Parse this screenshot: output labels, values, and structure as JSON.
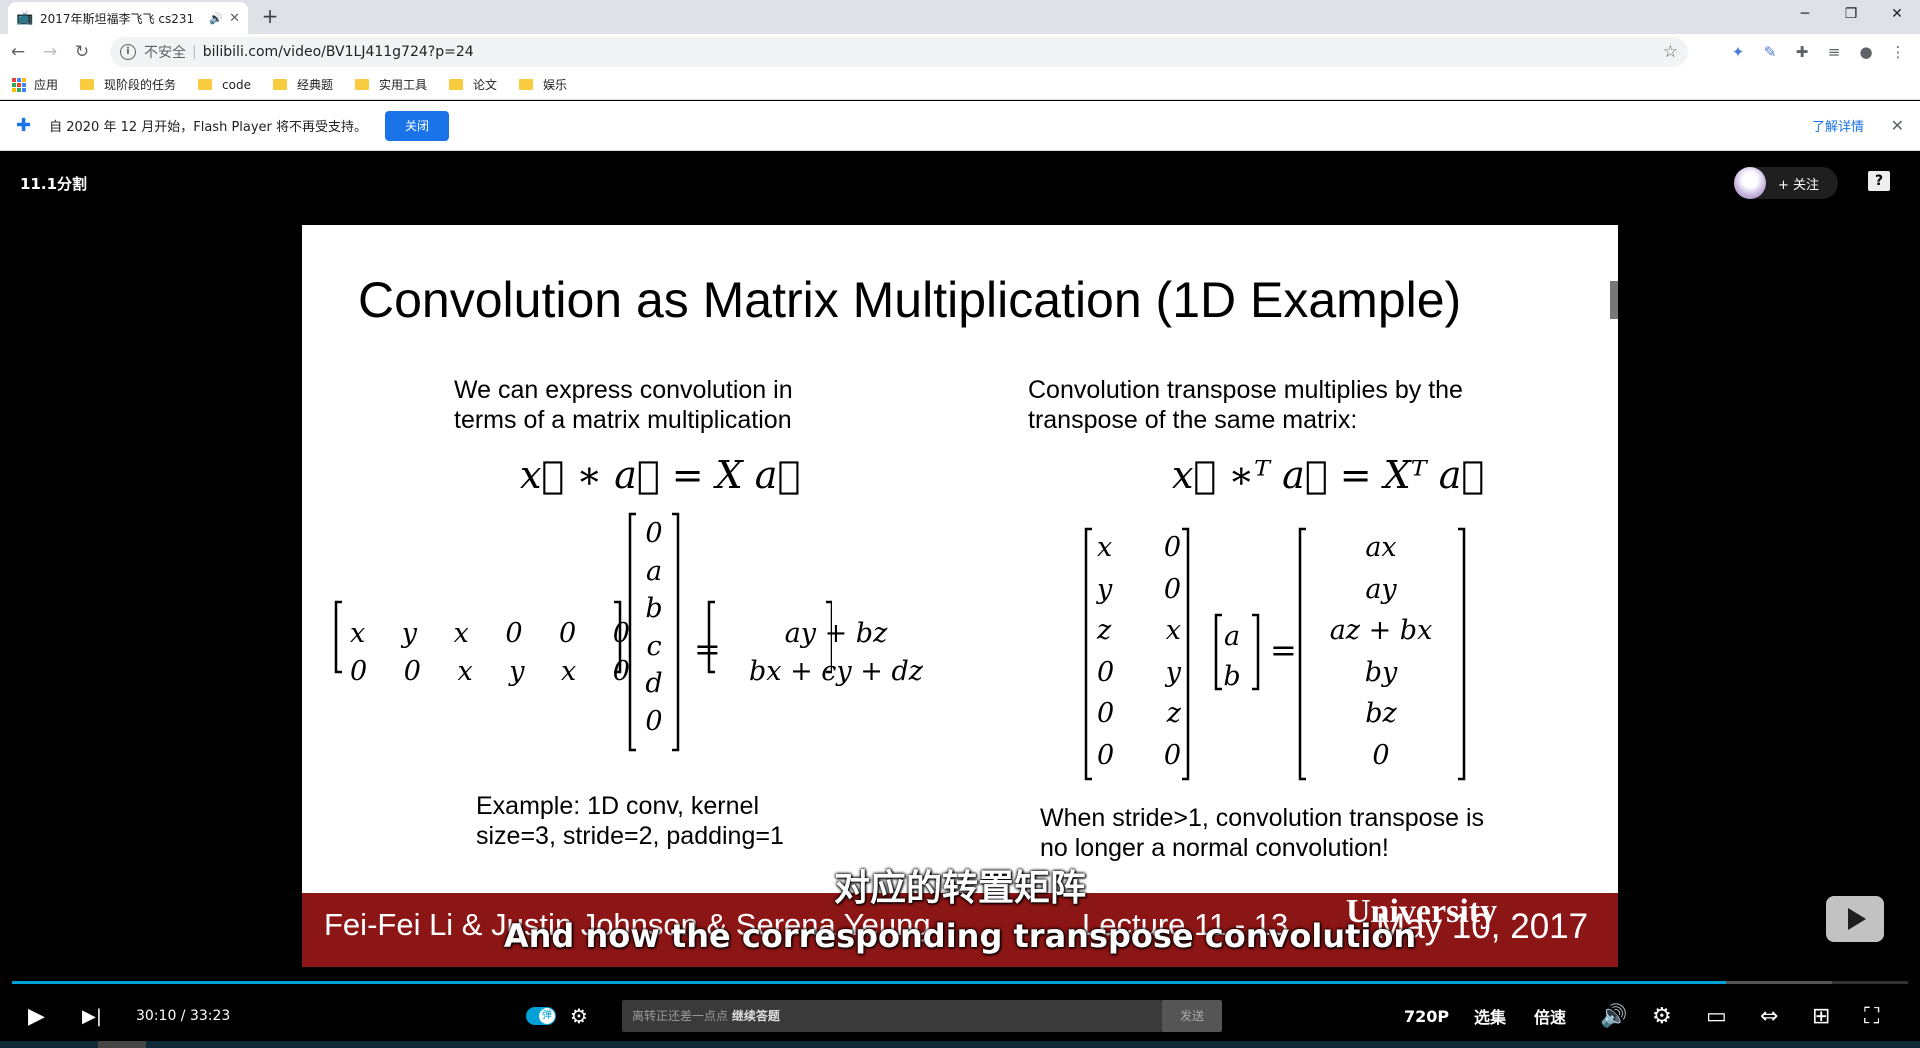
{
  "browser": {
    "tab_title": "2017年斯坦福李飞飞 cs231",
    "url_security": "不安全",
    "url": "bilibili.com/video/BV1LJ411g724?p=24",
    "new_tab": "+",
    "window": {
      "minimize": "─",
      "restore": "❐",
      "close": "✕"
    }
  },
  "bookmarks": [
    "应用",
    "现阶段的任务",
    "code",
    "经典题",
    "实用工具",
    "论文",
    "娱乐"
  ],
  "infobar": {
    "message": "自 2020 年 12 月开始，Flash Player 将不再受支持。",
    "close_label": "关闭",
    "learn_more": "了解详情"
  },
  "player": {
    "video_title": "11.1分割",
    "follow_label": "+ 关注",
    "help": "?",
    "subtitle_cn": "对应的转置矩阵",
    "subtitle_en": "And now the corresponding transpose convolution",
    "current_time": "30:10",
    "duration": "33:23",
    "progress": 0.904,
    "danmaku_placeholder_prefix": "离转正还差一点点",
    "danmaku_placeholder_action": "继续答题",
    "send_label": "发送",
    "quality": "720P",
    "episodes": "选集",
    "speed": "倍速"
  },
  "slide": {
    "title": "Convolution as Matrix Multiplication (1D Example)",
    "left_text": [
      "We can express convolution in",
      "terms of a matrix multiplication"
    ],
    "left_eq": "x⃗ ∗ a⃗ = X a⃗",
    "left_matrix": [
      [
        "x",
        "y",
        "x",
        "0",
        "0",
        "0"
      ],
      [
        "0",
        "0",
        "x",
        "y",
        "x",
        "0"
      ]
    ],
    "left_vector": [
      "0",
      "a",
      "b",
      "c",
      "d",
      "0"
    ],
    "left_result": [
      "ay + bz",
      "bx + cy + dz"
    ],
    "left_example": [
      "Example: 1D conv, kernel",
      "size=3, stride=2, padding=1"
    ],
    "right_text": [
      "Convolution transpose multiplies by the",
      "transpose of the same matrix:"
    ],
    "right_eq": "x⃗ ∗ᵀ a⃗ = Xᵀ a⃗",
    "right_matrix": [
      [
        "x",
        "0"
      ],
      [
        "y",
        "0"
      ],
      [
        "z",
        "x"
      ],
      [
        "0",
        "y"
      ],
      [
        "0",
        "z"
      ],
      [
        "0",
        "0"
      ]
    ],
    "right_vector": [
      "a",
      "b"
    ],
    "right_result": [
      "ax",
      "ay",
      "az + bx",
      "by",
      "bz",
      "0"
    ],
    "right_note": [
      "When stride>1, convolution transpose is",
      "no longer a normal convolution!"
    ],
    "footer_authors": "Fei-Fei Li & Justin Johnson & Serena Yeung",
    "footer_lecture": "Lecture 11 -",
    "footer_page": "13",
    "footer_date": "May 10, 2017",
    "footer_univ": "University"
  }
}
